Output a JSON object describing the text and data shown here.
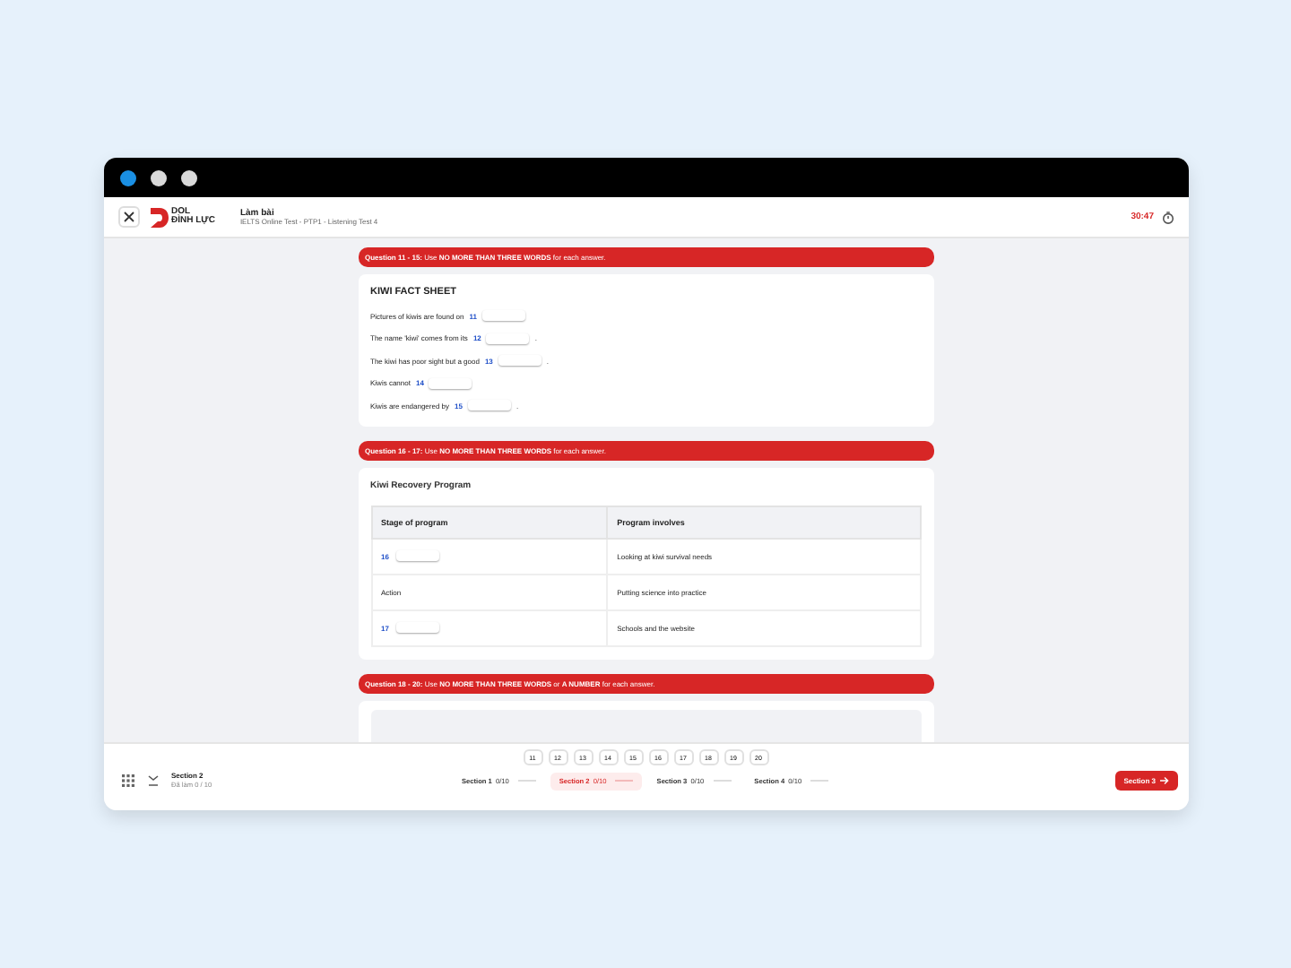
{
  "window": {
    "dots": [
      {
        "color": "#1a8fe3"
      },
      {
        "color": "#d9d9d9"
      },
      {
        "color": "#d9d9d9"
      }
    ]
  },
  "header": {
    "logo_top": "DOL",
    "logo_bottom": "ĐÌNH LỰC",
    "title": "Làm bài",
    "subtitle": "IELTS Online Test - PTP1 - Listening Test 4",
    "timer": "30:47"
  },
  "groups": [
    {
      "instruction": "**Question 11 - 15:** Use **NO MORE THAN THREE WORDS** for each answer.",
      "kind": "list",
      "title": "KIWI FACT SHEET",
      "items": [
        {
          "before": "Pictures of kiwis are found on",
          "number": "11"
        },
        {
          "before": "The name 'kiwi' comes from its",
          "number": "12",
          "after": "."
        },
        {
          "before": "The kiwi has poor sight but a good",
          "number": "13",
          "after": "."
        },
        {
          "before": "Kiwis cannot",
          "number": "14"
        },
        {
          "before": "Kiwis are endangered by",
          "number": "15",
          "after": "."
        }
      ]
    },
    {
      "instruction": "**Question 16 - 17:** Use **NO MORE THAN THREE WORDS** for each answer.",
      "kind": "table",
      "title": "Kiwi Recovery Program",
      "columns": [
        "Stage of program",
        "Program involves"
      ],
      "rows": [
        [
          {
            "kind": "blank",
            "number": "16"
          },
          {
            "kind": "text",
            "text": "Looking at kiwi survival needs"
          }
        ],
        [
          {
            "kind": "text",
            "text": "Action"
          },
          {
            "kind": "text",
            "text": "Putting science into practice"
          }
        ],
        [
          {
            "kind": "blank",
            "number": "17"
          },
          {
            "kind": "text",
            "text": "Schools and the website"
          }
        ]
      ]
    },
    {
      "instruction": "**Question 18 - 20:** Use **NO MORE THAN THREE WORDS** or **A NUMBER** for each answer.",
      "kind": "empty"
    }
  ],
  "question_nav": [
    "11",
    "12",
    "13",
    "14",
    "15",
    "16",
    "17",
    "18",
    "19",
    "20"
  ],
  "footer": {
    "section": "Section 2",
    "done": "Đã làm 0 / 10",
    "sections": [
      {
        "label": "Section 1",
        "count": "0/10",
        "selected": false
      },
      {
        "label": "Section 2",
        "count": "0/10",
        "selected": true
      },
      {
        "label": "Section 3",
        "count": "0/10",
        "selected": false
      },
      {
        "label": "Section 4",
        "count": "0/10",
        "selected": false
      }
    ],
    "next_button": "Section 3"
  }
}
